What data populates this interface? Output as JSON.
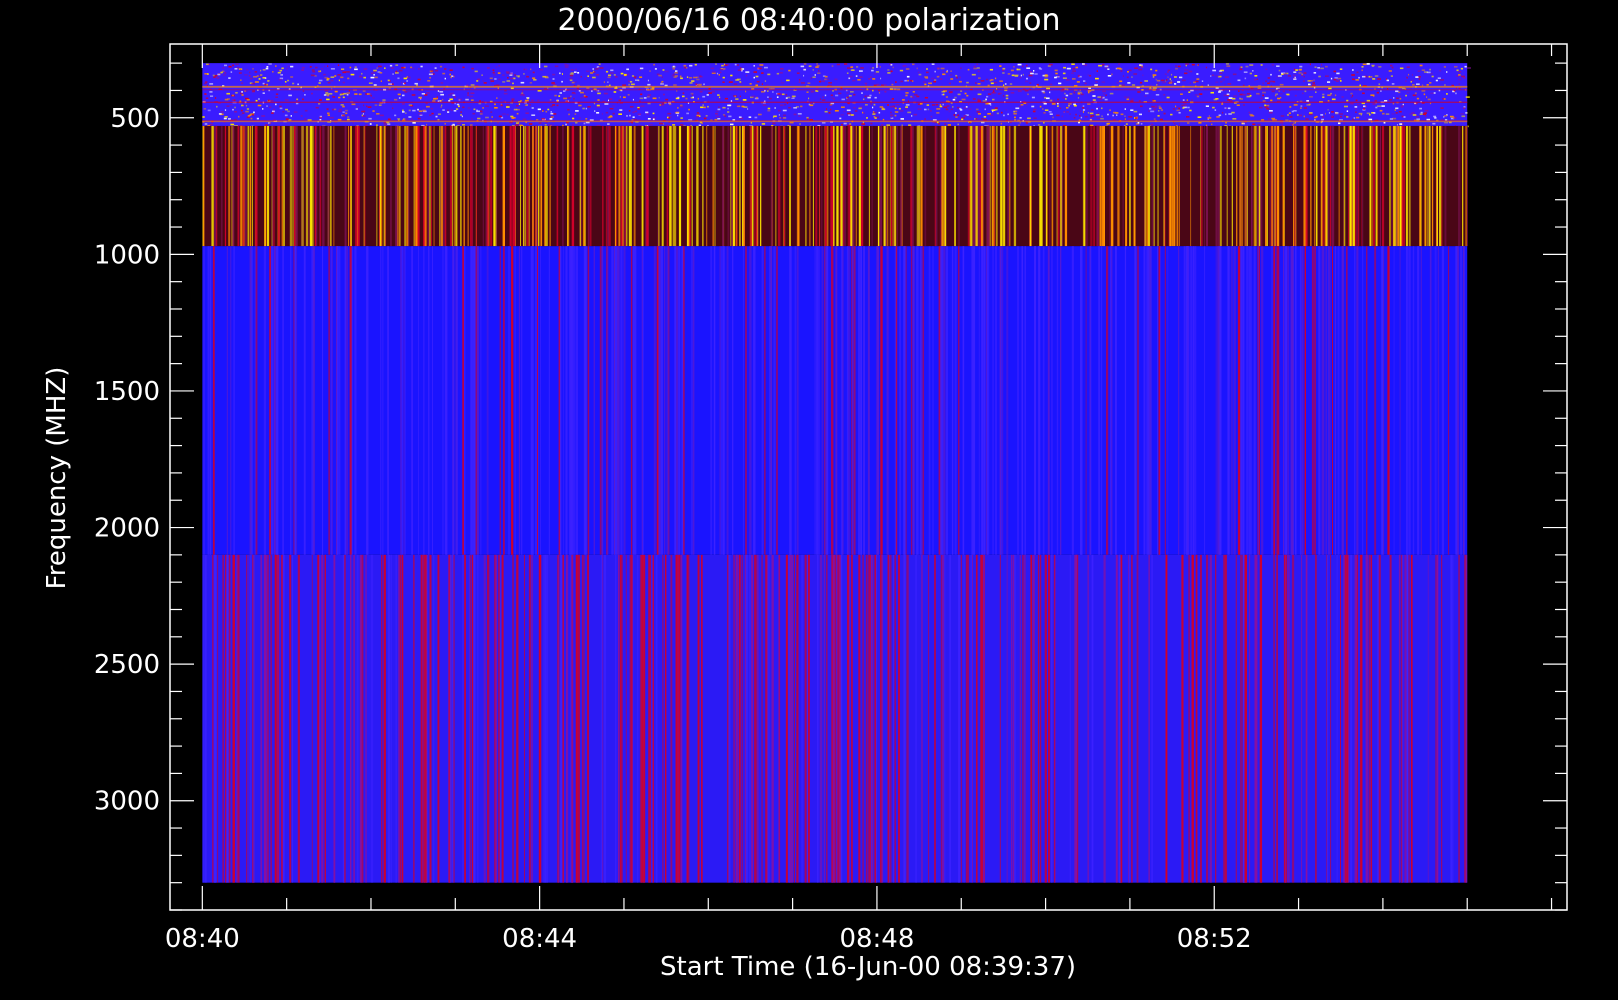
{
  "chart_data": {
    "type": "heatmap",
    "title": "2000/06/16 08:40:00 polarization",
    "xlabel": "Start Time (16-Jun-00 08:39:37)",
    "ylabel": "Frequency (MHZ)",
    "xlim": [
      "08:39:37",
      "08:56:11"
    ],
    "ylim": [
      3400,
      230
    ],
    "x_ticks": [
      "08:40",
      "08:44",
      "08:48",
      "08:52"
    ],
    "y_ticks": [
      500,
      1000,
      1500,
      2000,
      2500,
      3000
    ],
    "data_extent": {
      "x": [
        "08:40:00",
        "08:55:00"
      ],
      "y": [
        300,
        3300
      ]
    },
    "frequency_bands": [
      {
        "from": 300,
        "to": 530,
        "pattern": "noisy",
        "dominant_color": "#3a1cff"
      },
      {
        "from": 530,
        "to": 970,
        "pattern": "vertical-stripes",
        "dominant_color": "#4a0616"
      },
      {
        "from": 970,
        "to": 2100,
        "pattern": "vertical-stripes",
        "dominant_color": "#1a14ff"
      },
      {
        "from": 2100,
        "to": 3300,
        "pattern": "vertical-stripes",
        "dominant_color": "#2b1af5"
      }
    ],
    "colors": {
      "background": "#000000",
      "axes": "#ffffff",
      "blue": "#1a14ff",
      "red": "#d0002a",
      "yellow": "#ffe600",
      "orange": "#ff8c00"
    }
  }
}
